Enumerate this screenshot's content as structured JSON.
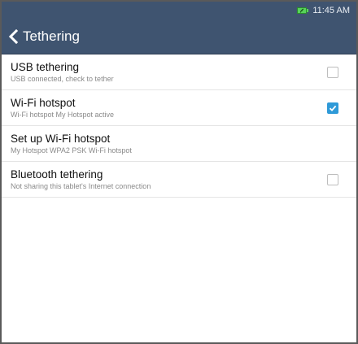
{
  "status_bar": {
    "time": "11:45 AM",
    "battery_icon": "battery-charging-icon",
    "battery_color": "#58d35a"
  },
  "app_bar": {
    "title": "Tethering",
    "back_icon": "chevron-left-icon",
    "color": "#3f5470"
  },
  "settings": [
    {
      "title": "USB tethering",
      "summary": "USB connected, check to tether",
      "has_checkbox": true,
      "checked": false
    },
    {
      "title": "Wi-Fi hotspot",
      "summary": "Wi-Fi hotspot My Hotspot active",
      "has_checkbox": true,
      "checked": true
    },
    {
      "title": "Set up Wi-Fi hotspot",
      "summary": "My Hotspot WPA2 PSK Wi-Fi hotspot",
      "has_checkbox": false,
      "checked": false
    },
    {
      "title": "Bluetooth tethering",
      "summary": "Not sharing this tablet's Internet connection",
      "has_checkbox": true,
      "checked": false
    }
  ],
  "accent_color": "#2f9ad8"
}
